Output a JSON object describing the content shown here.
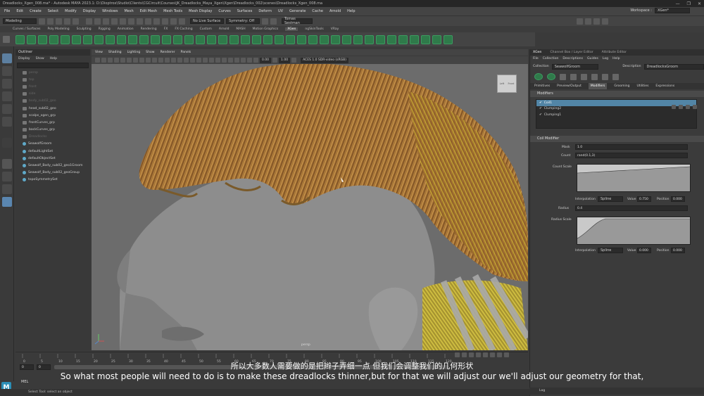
{
  "window": {
    "title": "Dreadlocks_Xgen_008.ma* - Autodesk MAYA 2023.1: D:\\Dioptrox\\Studio\\Clients\\CGCircuit\\Courses\\JK_Dreadlocks_Maya_Xgen\\Xgen\\Dreadlocks_002\\scenes\\Dreadlocks_Xgen_008.ma",
    "controls": [
      "—",
      "❐",
      "✕"
    ]
  },
  "menubar": {
    "items": [
      "File",
      "Edit",
      "Create",
      "Select",
      "Modify",
      "Display",
      "Windows",
      "Mesh",
      "Edit Mesh",
      "Mesh Tools",
      "Mesh Display",
      "Curves",
      "Surfaces",
      "Deform",
      "UV",
      "Generate",
      "Cache",
      "Arnold",
      "Help"
    ],
    "workspace_label": "Workspace :",
    "workspace_value": "XGen*"
  },
  "statusline": {
    "mode": "Modeling",
    "live_surface": "No Live Surface",
    "symmetry": "Symmetry: Off",
    "user": "Tomas Sestman"
  },
  "shelf_tabs": [
    "Curves / Surfaces",
    "Poly Modeling",
    "Sculpting",
    "Rigging",
    "Animation",
    "Rendering",
    "FX",
    "FX Caching",
    "Custom",
    "Arnold",
    "MASH",
    "Motion Graphics",
    "XGen",
    "ngSkinTools",
    "VRay"
  ],
  "shelf_active": "XGen",
  "outliner": {
    "title": "Outliner",
    "menu": [
      "Display",
      "Show",
      "Help"
    ],
    "items": [
      {
        "label": "persp",
        "dim": true
      },
      {
        "label": "top",
        "dim": true
      },
      {
        "label": "front",
        "dim": true
      },
      {
        "label": "side",
        "dim": true
      },
      {
        "label": "body_sub02_geo",
        "dim": true
      },
      {
        "label": "head_sub02_geo",
        "dim": false
      },
      {
        "label": "scalps_xgen_grp",
        "dim": false
      },
      {
        "label": "frontCurves_grp",
        "dim": false
      },
      {
        "label": "backCurves_grp",
        "dim": false
      },
      {
        "label": "Dreadlocks",
        "dim": true
      },
      {
        "label": "SeawolfGroom",
        "dim": false
      },
      {
        "label": "defaultLightSet",
        "dim": false
      },
      {
        "label": "defaultObjectSet",
        "dim": false
      },
      {
        "label": "Seawolf_Body_sub02_geo1Groom",
        "dim": false
      },
      {
        "label": "Seawolf_Body_sub02_geoGroup",
        "dim": false
      },
      {
        "label": "topoSymmetrySet",
        "dim": false
      }
    ]
  },
  "viewport": {
    "menu": [
      "View",
      "Shading",
      "Lighting",
      "Show",
      "Renderer",
      "Panels"
    ],
    "value1": "0.00",
    "value2": "1.00",
    "colorspace": "ACES 1.0 SDR-video (sRGB)",
    "camera": "persp",
    "viewcube_left": "Left",
    "viewcube_front": "Front"
  },
  "timeline": {
    "ticks": [
      "0",
      "5",
      "10",
      "15",
      "20",
      "25",
      "30",
      "35",
      "40",
      "45",
      "50",
      "55",
      "60",
      "65",
      "70",
      "75",
      "80",
      "85",
      "90",
      "95",
      "100",
      "105",
      "110",
      "115",
      "120"
    ],
    "start": "0",
    "range_start": "0"
  },
  "cmdline": {
    "mel": "MEL",
    "help": "Select Tool: select an object"
  },
  "xgen_panel": {
    "tabs": [
      "XGen",
      "Channel Box / Layer Editor",
      "Attribute Editor"
    ],
    "menu": [
      "File",
      "Collection",
      "Descriptions",
      "Guides",
      "Log",
      "Help"
    ],
    "collection_label": "Collection",
    "collection_value": "SeawolfGroom",
    "description_label": "Description",
    "description_value": "DreadlocksGroom",
    "subtabs": [
      "Primitives",
      "Preview/Output",
      "Modifiers",
      "Grooming",
      "Utilities",
      "Expressions"
    ],
    "active_subtab": "Modifiers",
    "modifiers_header": "Modifiers",
    "modifiers": [
      {
        "label": "Coil1",
        "selected": true
      },
      {
        "label": "Clumping2",
        "selected": false
      },
      {
        "label": "Clumping1",
        "selected": false
      }
    ],
    "coil_header": "Coil Modifier",
    "mask_label": "Mask",
    "mask_value": "1.0",
    "count_label": "Count",
    "count_value": "rand(0.1,3)",
    "count_scale_label": "Count Scale",
    "interp_label": "Interpolation",
    "interp_value1": "Spline",
    "value_label": "Value",
    "value1": "0.750",
    "position_label": "Position",
    "position1": "0.000",
    "radius_label": "Radius",
    "radius_value": "0.4",
    "radius_scale_label": "Radius Scale",
    "interp_value2": "Spline",
    "value2": "0.000",
    "position2": "0.000",
    "log_label": "Log"
  },
  "subtitles": {
    "chinese": "所以大多数人需要做的是把辫子弄细一点 但我们会调整我们的几何形状",
    "english": "So what most people will need to do is to make these dreadlocks thinner,but for that we will adjust our we'll adjust our geometry for that,"
  },
  "colors": {
    "hair_base": "#9c6a30",
    "hair_highlight": "#d3a053",
    "hair_yellow": "#c9b430",
    "head": "#8e8e8e",
    "selection_blue": "#5285a6",
    "xgen_green": "#2f7a4a"
  }
}
